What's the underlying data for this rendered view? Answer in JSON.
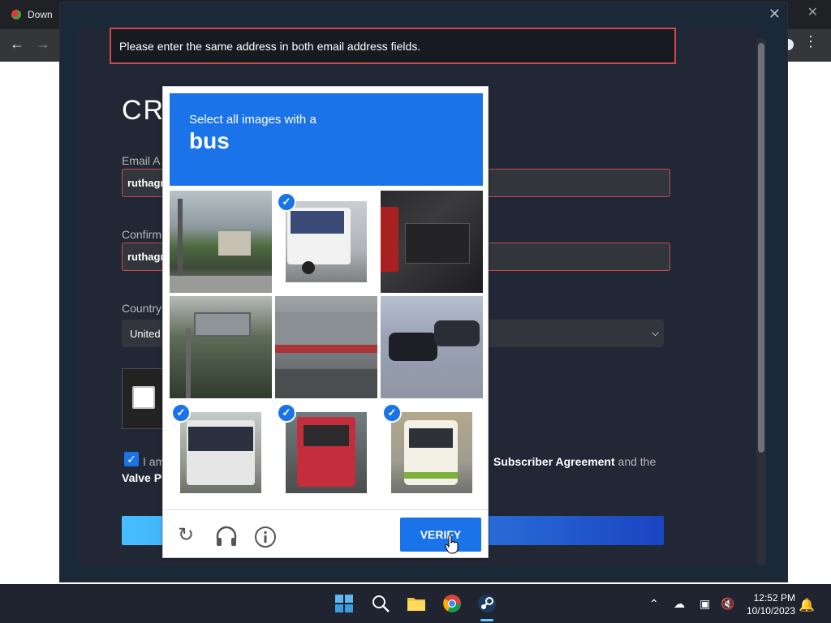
{
  "browser": {
    "tab_title": "Down",
    "close_label": "✕"
  },
  "steam": {
    "error_message": "Please enter the same address in both email address fields.",
    "create_title": "CRI",
    "email_label": "Email A",
    "email_value": "ruthagr",
    "confirm_label": "Confirm",
    "confirm_value": "ruthagr",
    "country_label": "Country",
    "country_value": "United",
    "agree_text_start": "I am",
    "agree_text_end_prefix": "",
    "subscriber_agreement": "Subscriber Agreement",
    "and_the": " and the",
    "valve_privacy": "Valve Pr"
  },
  "captcha": {
    "instruction": "Select all images with a",
    "target": "bus",
    "verify_label": "VERIFY",
    "tiles": [
      {
        "desc": "street-corner",
        "selected": false
      },
      {
        "desc": "white-van",
        "selected": true
      },
      {
        "desc": "red-car-closeup",
        "selected": false
      },
      {
        "desc": "billboard-trees",
        "selected": false
      },
      {
        "desc": "truck-side",
        "selected": false
      },
      {
        "desc": "parked-cars",
        "selected": false
      },
      {
        "desc": "coach-bus-front",
        "selected": true
      },
      {
        "desc": "red-bus-rear",
        "selected": true
      },
      {
        "desc": "white-bus-rear",
        "selected": true
      }
    ]
  },
  "taskbar": {
    "time": "12:52 PM",
    "date": "10/10/2023"
  },
  "colors": {
    "captcha_blue": "#1a73e8",
    "error_red": "#c64b4b",
    "steam_bg": "#1b2838"
  }
}
